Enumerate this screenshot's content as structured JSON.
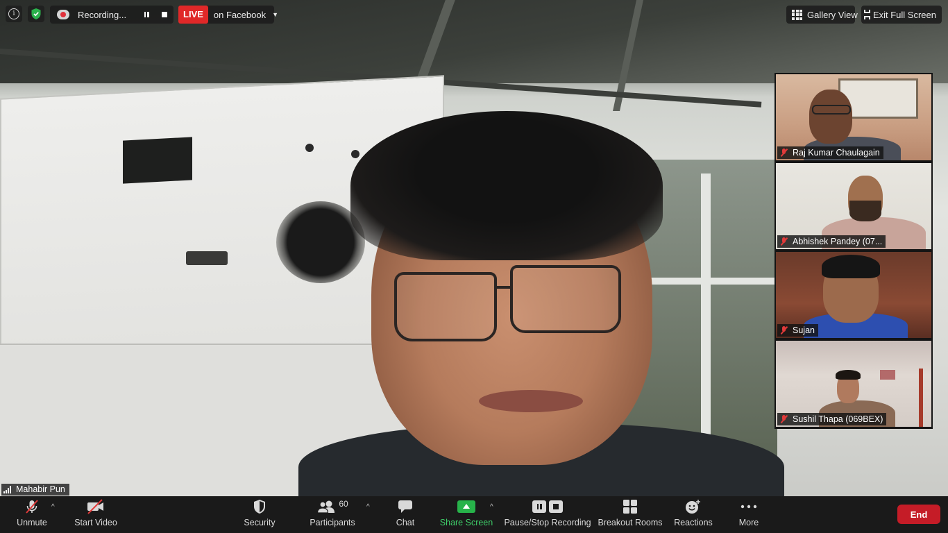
{
  "top_bar": {
    "recording_text": "Recording...",
    "live_badge": "LIVE",
    "live_target": "on Facebook",
    "gallery_view": "Gallery View",
    "exit_full_screen": "Exit Full Screen"
  },
  "main_speaker": {
    "name": "Mahabir Pun"
  },
  "thumbnails": [
    {
      "name": "Raj Kumar Chaulagain"
    },
    {
      "name": "Abhishek Pandey (07..."
    },
    {
      "name": "Sujan"
    },
    {
      "name": "Sushil Thapa (069BEX)"
    }
  ],
  "toolbar": {
    "unmute": "Unmute",
    "start_video": "Start Video",
    "security": "Security",
    "participants": "Participants",
    "participants_count": "60",
    "chat": "Chat",
    "share_screen": "Share Screen",
    "pause_stop_recording": "Pause/Stop Recording",
    "breakout_rooms": "Breakout Rooms",
    "reactions": "Reactions",
    "more": "More",
    "end": "End"
  },
  "colors": {
    "live_red": "#e02828",
    "share_green": "#27b34a",
    "end_red": "#c51c27",
    "toolbar_bg": "#1a1a1a",
    "muted_red": "#e23a3a"
  }
}
